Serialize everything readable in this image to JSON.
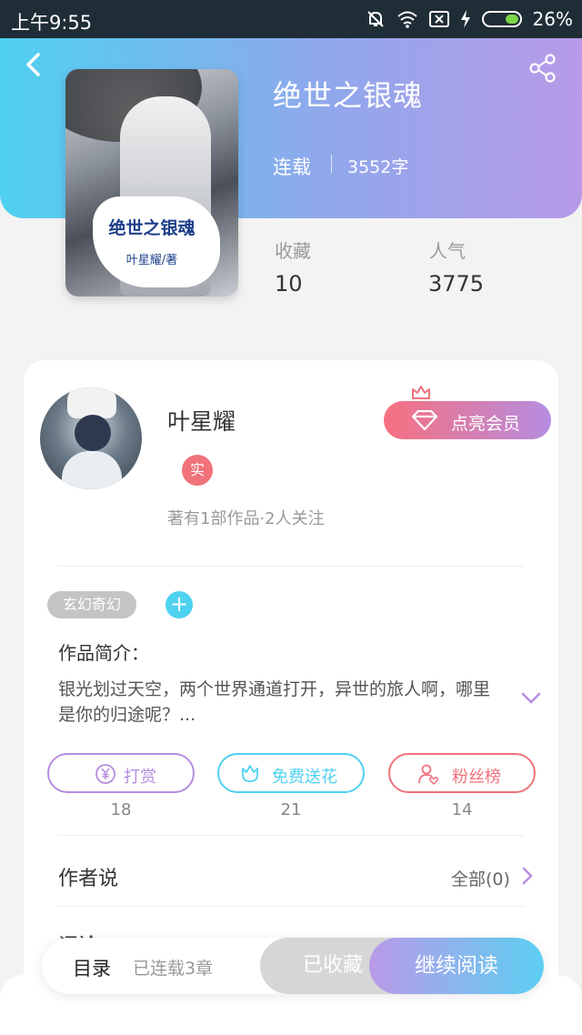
{
  "status_bar": {
    "time": "上午9:55",
    "battery": "26%"
  },
  "book": {
    "title": "绝世之银魂",
    "status": "连载",
    "word_count": "3552字",
    "cover_title": "绝世之银魂",
    "cover_author": "叶星耀/著"
  },
  "stats": [
    {
      "label": "收藏",
      "value": "10"
    },
    {
      "label": "人气",
      "value": "3775"
    }
  ],
  "author": {
    "name": "叶星耀",
    "badge": "实",
    "meta": "著有1部作品·2人关注",
    "vip_button": "点亮会员"
  },
  "tags": {
    "items": [
      "玄幻奇幻"
    ],
    "add": "+"
  },
  "intro": {
    "title": "作品简介：",
    "text": "银光划过天空，两个世界通道打开，异世的旅人啊，哪里是你的归途呢？..."
  },
  "actions": [
    {
      "label": "打赏",
      "count": "18",
      "color": "#b58de0"
    },
    {
      "label": "免费送花",
      "count": "21",
      "color": "#4fd1f0"
    },
    {
      "label": "粉丝榜",
      "count": "14",
      "color": "#f0727b"
    }
  ],
  "author_says": {
    "title": "作者说",
    "more": "全部(0)"
  },
  "next_section": {
    "title": "评论"
  },
  "bottom_bar": {
    "toc": "目录",
    "toc_sub": "已连载3章",
    "collected": "已收藏",
    "continue": "继续阅读"
  }
}
